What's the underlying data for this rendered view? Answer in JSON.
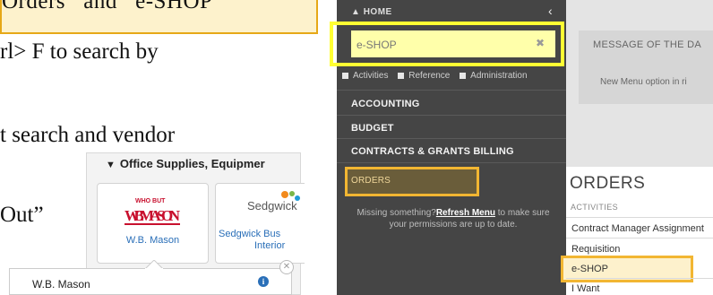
{
  "slide": {
    "callout_text": "Orders   and   e-SHOP",
    "line1": "rl> F to search by",
    "line2": "t search and vendor",
    "line3": "Out”"
  },
  "punchout": {
    "category": "Office Supplies, Equipmer",
    "vendors": [
      {
        "name": "W.B. Mason",
        "logo_top": "WHO BUT",
        "logo_main": "W.B.MASON"
      },
      {
        "name": "Sedgwick Bus… Interiors",
        "name_line1": "Sedgwick Bus",
        "name_line2": "Interior",
        "logo_main": "Sedgwick"
      }
    ],
    "popup_label": "W.B. Mason",
    "info_icon": "info-icon",
    "close_icon": "close-icon"
  },
  "app": {
    "home_label": "HOME",
    "search": {
      "value": "e-SHOP"
    },
    "view_tabs": [
      "Activities",
      "Reference",
      "Administration"
    ],
    "menu": [
      "ACCOUNTING",
      "BUDGET",
      "CONTRACTS & GRANTS BILLING",
      "ORDERS"
    ],
    "missing_pre": "Missing something?",
    "missing_link": "Refresh Menu",
    "missing_post": " to make sure your permissions are up to date.",
    "motd_title": "MESSAGE OF THE DA",
    "motd_body": "New Menu option in ri",
    "orders_title": "ORDERS",
    "activities_label": "ACTIVITIES",
    "activities": [
      "Contract Manager Assignment",
      "Requisition",
      "e-SHOP",
      "I Want"
    ]
  },
  "colors": {
    "highlight_yellow": "#ffff33",
    "highlight_gold": "#f2b632",
    "sidebar": "#454545",
    "link_blue": "#2a6fb8"
  }
}
